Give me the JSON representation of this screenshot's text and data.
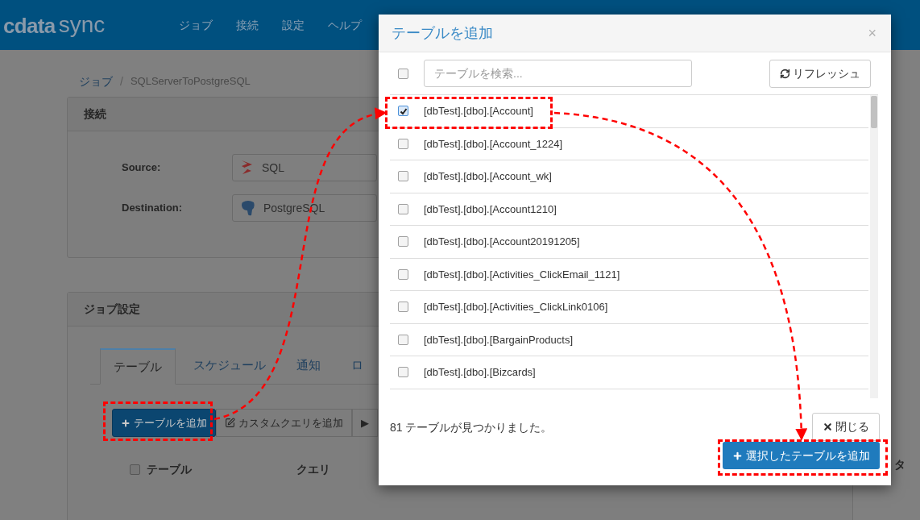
{
  "header": {
    "logo": {
      "part1": "cdata",
      "part2": "sync"
    },
    "nav": [
      "ジョブ",
      "接続",
      "設定",
      "ヘルプ"
    ]
  },
  "breadcrumb": {
    "parent": "ジョブ",
    "separator": "/",
    "current": "SQLServerToPostgreSQL"
  },
  "connection_panel": {
    "title": "接続",
    "rows": [
      {
        "label": "Source:",
        "value": "SQL",
        "kind": "sqlserver"
      },
      {
        "label": "Destination:",
        "value": "PostgreSQL",
        "kind": "postgres"
      }
    ]
  },
  "job_panel": {
    "title": "ジョブ設定",
    "tabs": [
      {
        "label": "テーブル",
        "selected": true
      },
      {
        "label": "スケジュール",
        "selected": false
      },
      {
        "label": "通知",
        "selected": false
      },
      {
        "label": "ロ",
        "selected": false
      }
    ],
    "buttons": [
      {
        "label": "テーブルを追加",
        "kind": "primary"
      },
      {
        "label": "カスタムクエリを追加",
        "kind": "edit"
      },
      {
        "label": "▶",
        "kind": "plain"
      }
    ],
    "table": {
      "select_all": false,
      "columns": [
        "テーブル",
        "クエリ"
      ],
      "column_3": "タ"
    }
  },
  "dialog": {
    "title": "テーブルを追加",
    "close": "×",
    "select_all": false,
    "search": {
      "placeholder": "テーブルを検索..."
    },
    "refresh": "リフレッシュ",
    "rows": [
      {
        "name": "[dbTest].[dbo].[Account]",
        "checked": true
      },
      {
        "name": "[dbTest].[dbo].[Account_1224]",
        "checked": false
      },
      {
        "name": "[dbTest].[dbo].[Account_wk]",
        "checked": false
      },
      {
        "name": "[dbTest].[dbo].[Account1210]",
        "checked": false
      },
      {
        "name": "[dbTest].[dbo].[Account20191205]",
        "checked": false
      },
      {
        "name": "[dbTest].[dbo].[Activities_ClickEmail_1121]",
        "checked": false
      },
      {
        "name": "[dbTest].[dbo].[Activities_ClickLink0106]",
        "checked": false
      },
      {
        "name": "[dbTest].[dbo].[BargainProducts]",
        "checked": false
      },
      {
        "name": "[dbTest].[dbo].[Bizcards]",
        "checked": false
      }
    ],
    "status": "81 テーブルが見つかりました。",
    "close_button": "閉じる",
    "add_button": "選択したテーブルを追加"
  }
}
